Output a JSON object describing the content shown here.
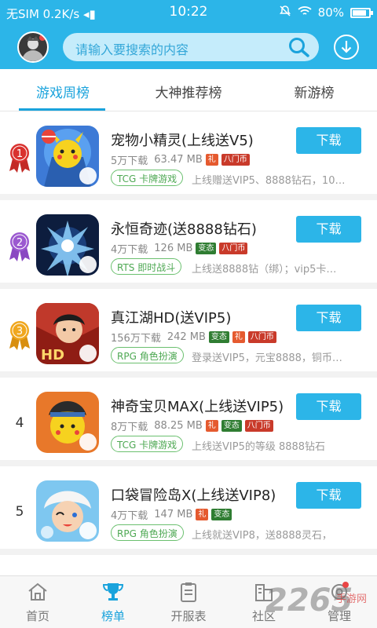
{
  "status": {
    "carrier": "无SIM",
    "speed": "0.2K/s",
    "time": "10:22",
    "battery": "80%"
  },
  "search": {
    "placeholder": "请输入要搜索的内容"
  },
  "tabs": [
    {
      "label": "游戏周榜",
      "active": true
    },
    {
      "label": "大神推荐榜",
      "active": false
    },
    {
      "label": "新游榜",
      "active": false
    }
  ],
  "items": [
    {
      "rank": "1",
      "title": "宠物小精灵(上线送V5)",
      "downloads": "5万下载",
      "size": "63.47 MB",
      "tags": [
        "礼",
        "八门币"
      ],
      "category": "TCG 卡牌游戏",
      "desc": "上线赠送VIP5、8888钻石，10…",
      "button": "下载"
    },
    {
      "rank": "2",
      "title": "永恒奇迹(送8888钻石)",
      "downloads": "4万下载",
      "size": "126 MB",
      "tags": [
        "变态",
        "八门币"
      ],
      "category": "RTS 即时战斗",
      "desc": "上线送8888钻（绑）；vip5卡…",
      "button": "下载"
    },
    {
      "rank": "3",
      "title": "真江湖HD(送VIP5)",
      "downloads": "156万下载",
      "size": "242 MB",
      "tags": [
        "变态",
        "礼",
        "八门币"
      ],
      "category": "RPG 角色扮演",
      "desc": "登录送VIP5，元宝8888，铜币…",
      "button": "下载"
    },
    {
      "rank": "4",
      "title": "神奇宝贝MAX(上线送VIP5)",
      "downloads": "8万下载",
      "size": "88.25 MB",
      "tags": [
        "礼",
        "变态",
        "八门币"
      ],
      "category": "TCG 卡牌游戏",
      "desc": "上线送VIP5的等级 8888钻石",
      "button": "下载"
    },
    {
      "rank": "5",
      "title": "口袋冒险岛X(上线送VIP8)",
      "downloads": "4万下载",
      "size": "147 MB",
      "tags": [
        "礼",
        "变态"
      ],
      "category": "RPG 角色扮演",
      "desc": "上线就送VIP8，送8888灵石，",
      "button": "下载"
    }
  ],
  "colors": {
    "accent": "#2cb5e8",
    "rank1": "#d9322f",
    "rank2": "#9b59d0",
    "rank3": "#f0a71e"
  },
  "nav": [
    {
      "label": "首页",
      "icon": "home-icon",
      "active": false
    },
    {
      "label": "榜单",
      "icon": "trophy-icon",
      "active": true
    },
    {
      "label": "开服表",
      "icon": "clipboard-icon",
      "active": false
    },
    {
      "label": "社区",
      "icon": "community-icon",
      "active": false
    },
    {
      "label": "管理",
      "icon": "manage-icon",
      "active": false
    }
  ],
  "watermark": {
    "text": "2265",
    "sub": "手游网"
  }
}
